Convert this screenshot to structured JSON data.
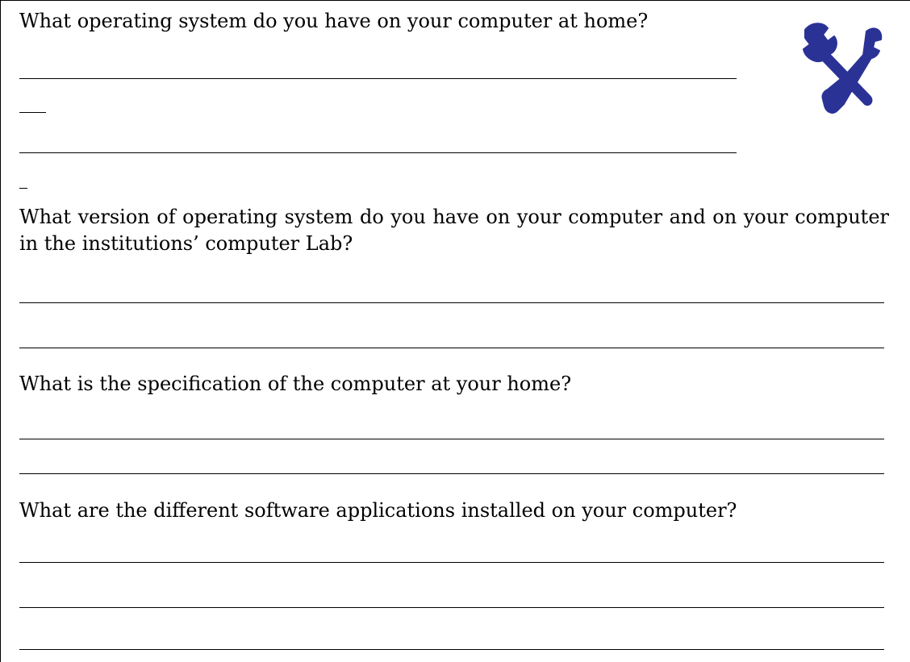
{
  "questions": [
    "What operating system do you have on your computer at home?",
    "What version of operating system do you have on your computer and on your computer in the institutions’ computer Lab?",
    "What is the specification of the computer at your home?",
    "What are the different software applications installed on your computer?"
  ],
  "icon": {
    "name": "tools-icon",
    "color": "#2b3296"
  }
}
